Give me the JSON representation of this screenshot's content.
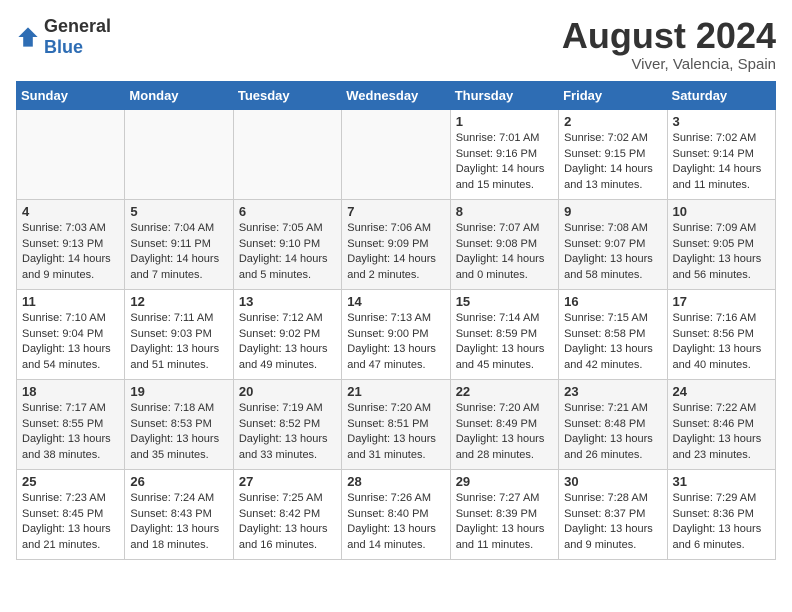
{
  "logo": {
    "text_general": "General",
    "text_blue": "Blue"
  },
  "title": "August 2024",
  "subtitle": "Viver, Valencia, Spain",
  "days_of_week": [
    "Sunday",
    "Monday",
    "Tuesday",
    "Wednesday",
    "Thursday",
    "Friday",
    "Saturday"
  ],
  "weeks": [
    [
      {
        "day": "",
        "info": ""
      },
      {
        "day": "",
        "info": ""
      },
      {
        "day": "",
        "info": ""
      },
      {
        "day": "",
        "info": ""
      },
      {
        "day": "1",
        "info": "Sunrise: 7:01 AM\nSunset: 9:16 PM\nDaylight: 14 hours and 15 minutes."
      },
      {
        "day": "2",
        "info": "Sunrise: 7:02 AM\nSunset: 9:15 PM\nDaylight: 14 hours and 13 minutes."
      },
      {
        "day": "3",
        "info": "Sunrise: 7:02 AM\nSunset: 9:14 PM\nDaylight: 14 hours and 11 minutes."
      }
    ],
    [
      {
        "day": "4",
        "info": "Sunrise: 7:03 AM\nSunset: 9:13 PM\nDaylight: 14 hours and 9 minutes."
      },
      {
        "day": "5",
        "info": "Sunrise: 7:04 AM\nSunset: 9:11 PM\nDaylight: 14 hours and 7 minutes."
      },
      {
        "day": "6",
        "info": "Sunrise: 7:05 AM\nSunset: 9:10 PM\nDaylight: 14 hours and 5 minutes."
      },
      {
        "day": "7",
        "info": "Sunrise: 7:06 AM\nSunset: 9:09 PM\nDaylight: 14 hours and 2 minutes."
      },
      {
        "day": "8",
        "info": "Sunrise: 7:07 AM\nSunset: 9:08 PM\nDaylight: 14 hours and 0 minutes."
      },
      {
        "day": "9",
        "info": "Sunrise: 7:08 AM\nSunset: 9:07 PM\nDaylight: 13 hours and 58 minutes."
      },
      {
        "day": "10",
        "info": "Sunrise: 7:09 AM\nSunset: 9:05 PM\nDaylight: 13 hours and 56 minutes."
      }
    ],
    [
      {
        "day": "11",
        "info": "Sunrise: 7:10 AM\nSunset: 9:04 PM\nDaylight: 13 hours and 54 minutes."
      },
      {
        "day": "12",
        "info": "Sunrise: 7:11 AM\nSunset: 9:03 PM\nDaylight: 13 hours and 51 minutes."
      },
      {
        "day": "13",
        "info": "Sunrise: 7:12 AM\nSunset: 9:02 PM\nDaylight: 13 hours and 49 minutes."
      },
      {
        "day": "14",
        "info": "Sunrise: 7:13 AM\nSunset: 9:00 PM\nDaylight: 13 hours and 47 minutes."
      },
      {
        "day": "15",
        "info": "Sunrise: 7:14 AM\nSunset: 8:59 PM\nDaylight: 13 hours and 45 minutes."
      },
      {
        "day": "16",
        "info": "Sunrise: 7:15 AM\nSunset: 8:58 PM\nDaylight: 13 hours and 42 minutes."
      },
      {
        "day": "17",
        "info": "Sunrise: 7:16 AM\nSunset: 8:56 PM\nDaylight: 13 hours and 40 minutes."
      }
    ],
    [
      {
        "day": "18",
        "info": "Sunrise: 7:17 AM\nSunset: 8:55 PM\nDaylight: 13 hours and 38 minutes."
      },
      {
        "day": "19",
        "info": "Sunrise: 7:18 AM\nSunset: 8:53 PM\nDaylight: 13 hours and 35 minutes."
      },
      {
        "day": "20",
        "info": "Sunrise: 7:19 AM\nSunset: 8:52 PM\nDaylight: 13 hours and 33 minutes."
      },
      {
        "day": "21",
        "info": "Sunrise: 7:20 AM\nSunset: 8:51 PM\nDaylight: 13 hours and 31 minutes."
      },
      {
        "day": "22",
        "info": "Sunrise: 7:20 AM\nSunset: 8:49 PM\nDaylight: 13 hours and 28 minutes."
      },
      {
        "day": "23",
        "info": "Sunrise: 7:21 AM\nSunset: 8:48 PM\nDaylight: 13 hours and 26 minutes."
      },
      {
        "day": "24",
        "info": "Sunrise: 7:22 AM\nSunset: 8:46 PM\nDaylight: 13 hours and 23 minutes."
      }
    ],
    [
      {
        "day": "25",
        "info": "Sunrise: 7:23 AM\nSunset: 8:45 PM\nDaylight: 13 hours and 21 minutes."
      },
      {
        "day": "26",
        "info": "Sunrise: 7:24 AM\nSunset: 8:43 PM\nDaylight: 13 hours and 18 minutes."
      },
      {
        "day": "27",
        "info": "Sunrise: 7:25 AM\nSunset: 8:42 PM\nDaylight: 13 hours and 16 minutes."
      },
      {
        "day": "28",
        "info": "Sunrise: 7:26 AM\nSunset: 8:40 PM\nDaylight: 13 hours and 14 minutes."
      },
      {
        "day": "29",
        "info": "Sunrise: 7:27 AM\nSunset: 8:39 PM\nDaylight: 13 hours and 11 minutes."
      },
      {
        "day": "30",
        "info": "Sunrise: 7:28 AM\nSunset: 8:37 PM\nDaylight: 13 hours and 9 minutes."
      },
      {
        "day": "31",
        "info": "Sunrise: 7:29 AM\nSunset: 8:36 PM\nDaylight: 13 hours and 6 minutes."
      }
    ]
  ]
}
